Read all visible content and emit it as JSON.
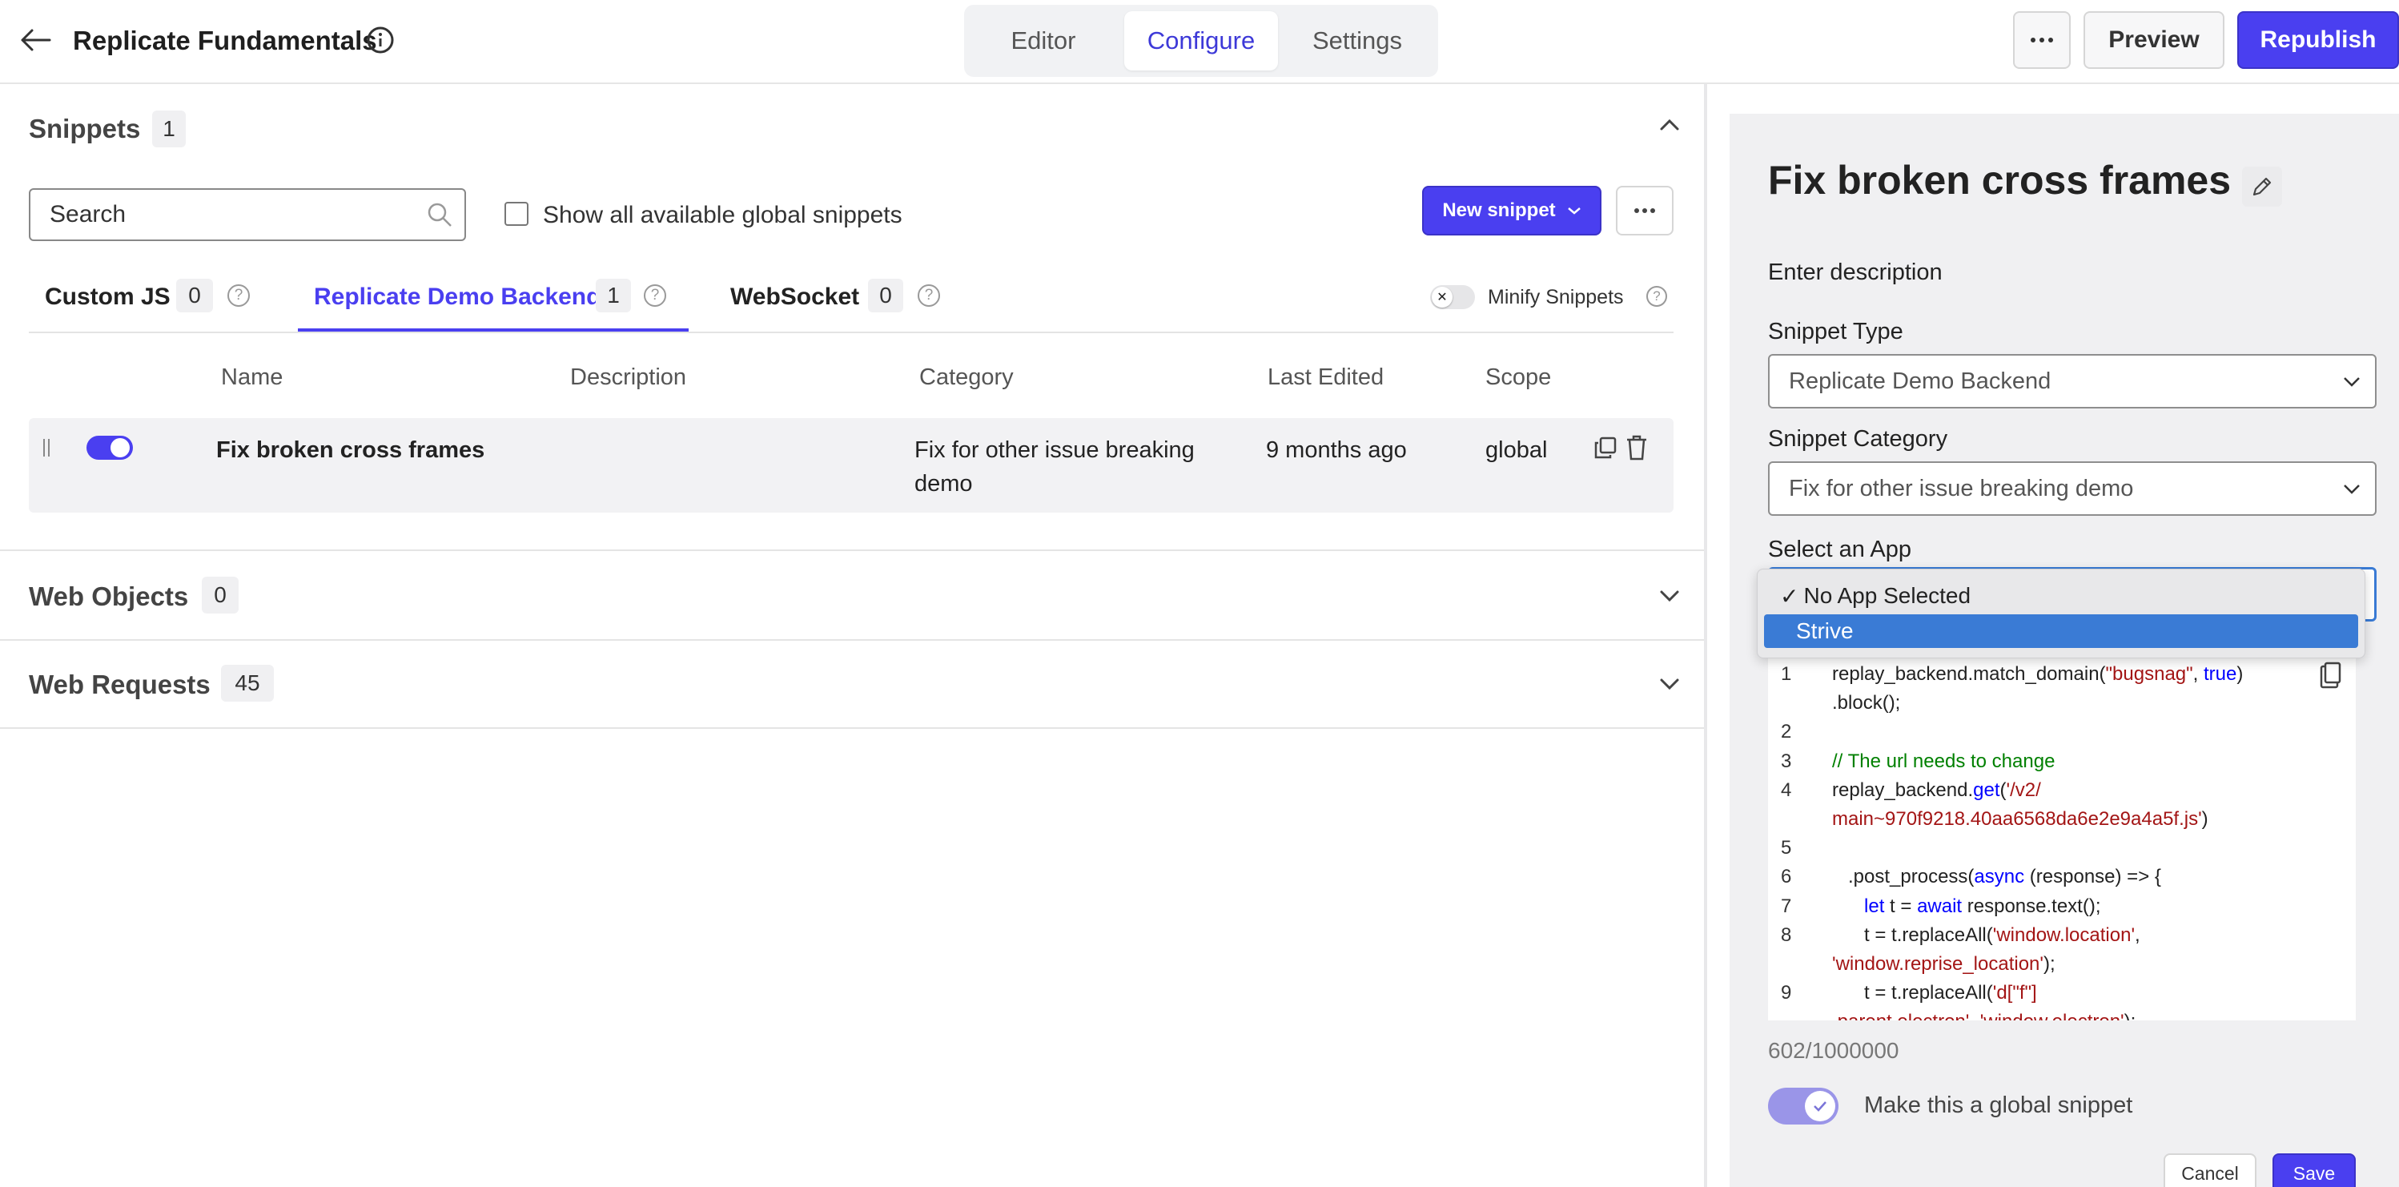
{
  "header": {
    "back_icon": "arrow-left-icon",
    "title": "Replicate Fundamentals",
    "info_icon": "info-icon",
    "tabs": [
      {
        "label": "Editor",
        "active": false
      },
      {
        "label": "Configure",
        "active": true
      },
      {
        "label": "Settings",
        "active": false
      }
    ],
    "more_icon": "ellipsis-icon",
    "preview_label": "Preview",
    "republish_label": "Republish"
  },
  "snippets": {
    "title": "Snippets",
    "count": "1",
    "search_placeholder": "Search",
    "show_global_label": "Show all available global snippets",
    "new_snippet_label": "New snippet",
    "subtabs": [
      {
        "label": "Custom JS",
        "count": "0"
      },
      {
        "label": "Replicate Demo Backend",
        "count": "1"
      },
      {
        "label": "WebSocket",
        "count": "0"
      }
    ],
    "minify_label": "Minify Snippets",
    "columns": [
      "Name",
      "Description",
      "Category",
      "Last Edited",
      "Scope"
    ],
    "rows": [
      {
        "name": "Fix broken cross frames",
        "description": "",
        "category_line1": "Fix for other issue breaking",
        "category_line2": "demo",
        "last_edited": "9 months ago",
        "scope": "global"
      }
    ]
  },
  "web_objects": {
    "title": "Web Objects",
    "count": "0"
  },
  "web_requests": {
    "title": "Web Requests",
    "count": "45"
  },
  "editor": {
    "title": "Fix broken cross frames",
    "description_placeholder": "Enter description",
    "snippet_type_label": "Snippet Type",
    "snippet_type_value": "Replicate Demo Backend",
    "snippet_category_label": "Snippet Category",
    "snippet_category_value": "Fix for other issue breaking demo",
    "select_app_label": "Select an App",
    "app_options": [
      {
        "label": "No App Selected",
        "checked": true,
        "highlighted": false
      },
      {
        "label": "Strive",
        "checked": false,
        "highlighted": true
      }
    ],
    "char_count": "602/1000000",
    "global_toggle_label": "Make this a global snippet",
    "cancel_label": "Cancel",
    "save_label": "Save",
    "accent_color": "#4a3ff0"
  },
  "code_lines": [
    {
      "n": "1",
      "parts": [
        [
          "replay_backend.match_domain(",
          ""
        ],
        [
          "\"bugsnag\"",
          "str"
        ],
        [
          ", ",
          ""
        ],
        [
          "true",
          "kw"
        ],
        [
          ")",
          ""
        ]
      ]
    },
    {
      "n": "",
      "parts": [
        [
          ".block();",
          ""
        ]
      ]
    },
    {
      "n": "2",
      "parts": []
    },
    {
      "n": "3",
      "parts": [
        [
          "// The url needs to change",
          "cm"
        ]
      ]
    },
    {
      "n": "4",
      "parts": [
        [
          "replay_backend.",
          ""
        ],
        [
          "get",
          "kw"
        ],
        [
          "(",
          ""
        ],
        [
          "'/v2/",
          "str"
        ]
      ]
    },
    {
      "n": "",
      "parts": [
        [
          "main~970f9218.40aa6568da6e2e9a4a5f.js'",
          "str"
        ],
        [
          ")",
          ""
        ]
      ]
    },
    {
      "n": "5",
      "parts": []
    },
    {
      "n": "6",
      "parts": [
        [
          "   .post_process(",
          ""
        ],
        [
          "async",
          "kw"
        ],
        [
          " (response) => {",
          ""
        ]
      ]
    },
    {
      "n": "7",
      "parts": [
        [
          "      ",
          ""
        ],
        [
          "let",
          "kw"
        ],
        [
          " t = ",
          ""
        ],
        [
          "await",
          "kw"
        ],
        [
          " response.text();",
          ""
        ]
      ]
    },
    {
      "n": "8",
      "parts": [
        [
          "      t = t.replaceAll(",
          ""
        ],
        [
          "'window.location'",
          "str"
        ],
        [
          ",",
          ""
        ]
      ]
    },
    {
      "n": "",
      "parts": [
        [
          "'window.reprise_location'",
          "str"
        ],
        [
          ");",
          ""
        ]
      ]
    },
    {
      "n": "9",
      "parts": [
        [
          "      t = t.replaceAll(",
          ""
        ],
        [
          "'d[\"f\"]",
          "str"
        ]
      ]
    },
    {
      "n": "",
      "parts": [
        [
          ".parent.electron'",
          "str"
        ],
        [
          ", ",
          ""
        ],
        [
          "'window.electron'",
          "str"
        ],
        [
          ");",
          ""
        ]
      ]
    }
  ]
}
